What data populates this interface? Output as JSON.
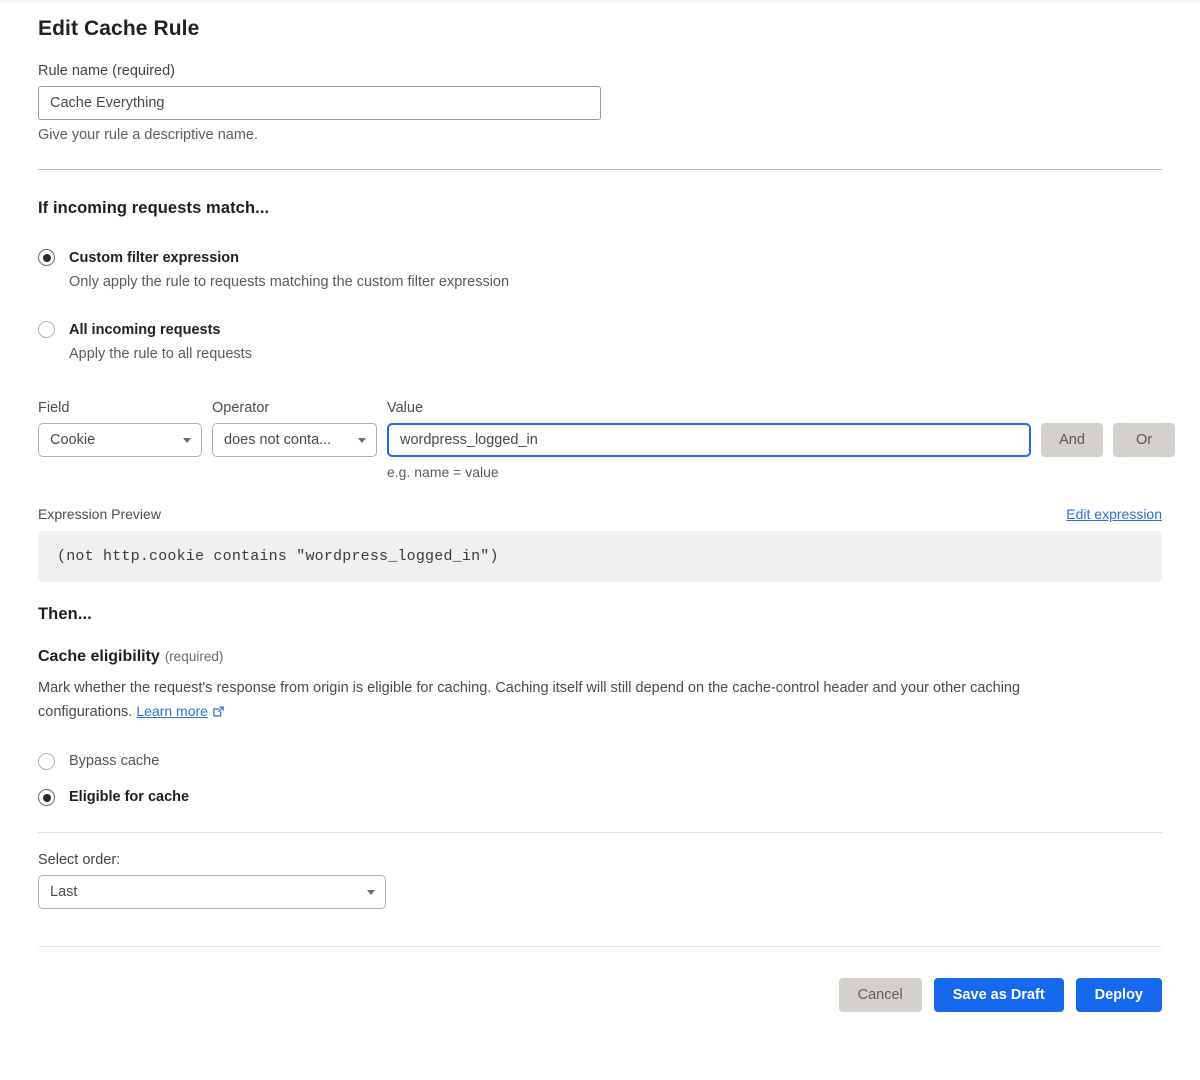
{
  "page": {
    "title": "Edit Cache Rule"
  },
  "rule_name": {
    "label": "Rule name (required)",
    "value": "Cache Everything",
    "placeholder": "Rule name",
    "help": "Give your rule a descriptive name."
  },
  "match_section": {
    "heading": "If incoming requests match...",
    "options": [
      {
        "title": "Custom filter expression",
        "description": "Only apply the rule to requests matching the custom filter expression",
        "selected": true
      },
      {
        "title": "All incoming requests",
        "description": "Apply the rule to all requests",
        "selected": false
      }
    ]
  },
  "filter": {
    "field_label": "Field",
    "field_value": "Cookie",
    "operator_label": "Operator",
    "operator_value": "does not conta...",
    "value_label": "Value",
    "value_value": "wordpress_logged_in",
    "value_placeholder": "Value",
    "value_hint": "e.g. name = value",
    "and_label": "And",
    "or_label": "Or"
  },
  "preview": {
    "label": "Expression Preview",
    "edit_link": "Edit expression",
    "expression": "(not http.cookie contains \"wordpress_logged_in\")"
  },
  "then_section": {
    "heading": "Then...",
    "cache_eligibility_title": "Cache eligibility",
    "cache_eligibility_required": "(required)",
    "description_part1": "Mark whether the request's response from origin is eligible for caching. Caching itself will still depend on the cache-control header and your other caching configurations. ",
    "learn_more": "Learn more",
    "options": [
      {
        "label": "Bypass cache",
        "selected": false
      },
      {
        "label": "Eligible for cache",
        "selected": true
      }
    ]
  },
  "order": {
    "label": "Select order:",
    "value": "Last"
  },
  "footer": {
    "cancel": "Cancel",
    "save_draft": "Save as Draft",
    "deploy": "Deploy"
  },
  "colors": {
    "primary_blue": "#1668ef",
    "link_blue": "#2b6fd6",
    "focus_blue": "#1a6fe8",
    "button_grey": "#d4d1cd",
    "preview_bg": "#eef1f0"
  }
}
